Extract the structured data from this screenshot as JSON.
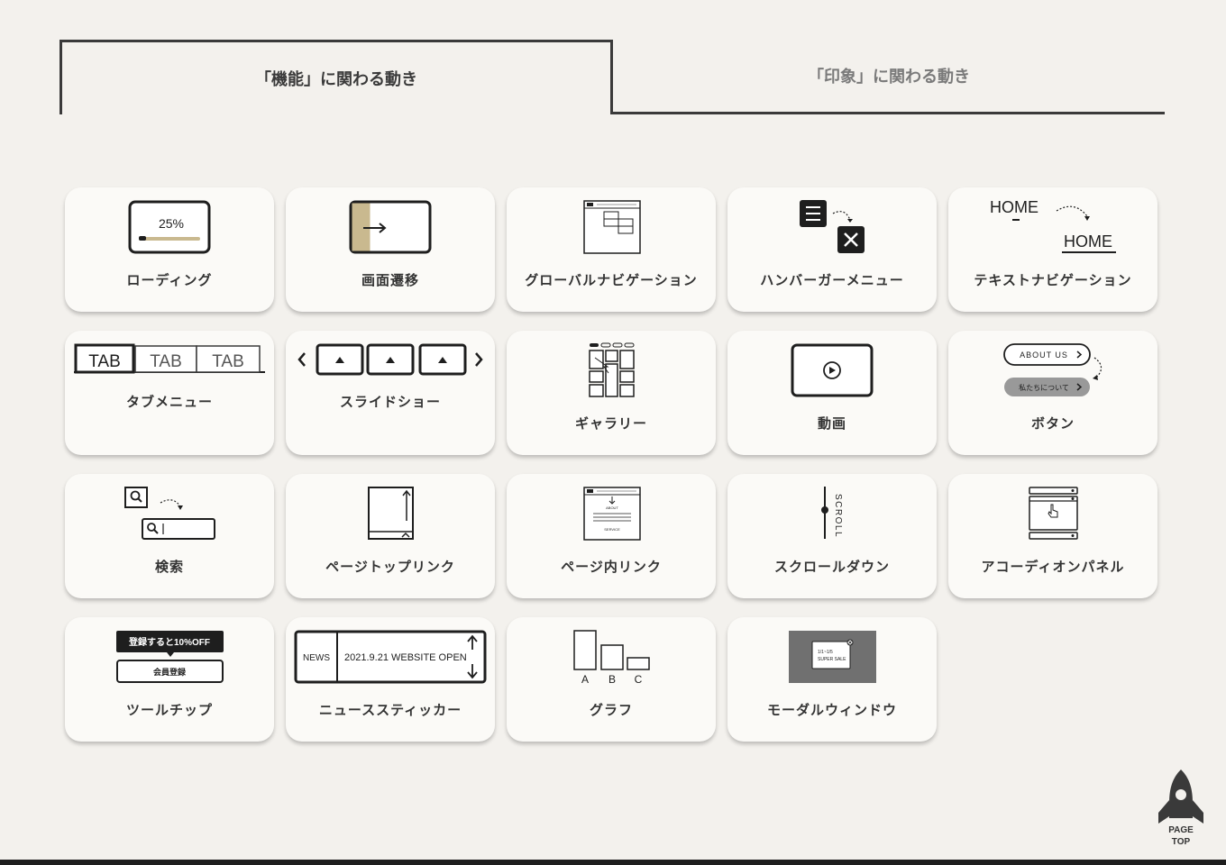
{
  "tabs": {
    "function": "「機能」に関わる動き",
    "impression": "「印象」に関わる動き"
  },
  "cards": [
    {
      "id": "loading",
      "label": "ローディング",
      "icon_text": "25%",
      "progress_fraction": 0.12
    },
    {
      "id": "page-transition",
      "label": "画面遷移"
    },
    {
      "id": "global-nav",
      "label": "グローバルナビゲーション"
    },
    {
      "id": "hamburger",
      "label": "ハンバーガーメニュー"
    },
    {
      "id": "text-nav",
      "label": "テキストナビゲーション",
      "icon_text": "HOME"
    },
    {
      "id": "tab-menu",
      "label": "タブメニュー",
      "icon_text": "TAB"
    },
    {
      "id": "slideshow",
      "label": "スライドショー"
    },
    {
      "id": "gallery",
      "label": "ギャラリー"
    },
    {
      "id": "video",
      "label": "動画"
    },
    {
      "id": "button",
      "label": "ボタン",
      "icon_text": "ABOUT US",
      "icon_text2": "私たちについて"
    },
    {
      "id": "search",
      "label": "検索"
    },
    {
      "id": "page-top-link",
      "label": "ページトップリンク"
    },
    {
      "id": "in-page-link",
      "label": "ページ内リンク",
      "icon_text": "ABOUT",
      "icon_text2": "SERVICE"
    },
    {
      "id": "scroll-down",
      "label": "スクロールダウン",
      "icon_text": "SCROLL"
    },
    {
      "id": "accordion",
      "label": "アコーディオンパネル"
    },
    {
      "id": "tooltip",
      "label": "ツールチップ",
      "icon_text": "登録すると10%OFF",
      "icon_text2": "会員登録"
    },
    {
      "id": "news-ticker",
      "label": "ニューススティッカー",
      "icon_text": "NEWS",
      "icon_text2": "2021.9.21 WEBSITE OPEN"
    },
    {
      "id": "graph",
      "label": "グラフ",
      "icon_labels": [
        "A",
        "B",
        "C"
      ]
    },
    {
      "id": "modal",
      "label": "モーダルウィンドウ",
      "icon_text": "1/1~1/5",
      "icon_text2": "SUPER SALE"
    }
  ],
  "page_top": {
    "line1": "PAGE",
    "line2": "TOP"
  },
  "colors": {
    "background": "#f3f1ed",
    "card": "#fbfaf7",
    "accent": "#c9b98f",
    "dark": "#1e1e1e",
    "modal_gray": "#707070"
  }
}
